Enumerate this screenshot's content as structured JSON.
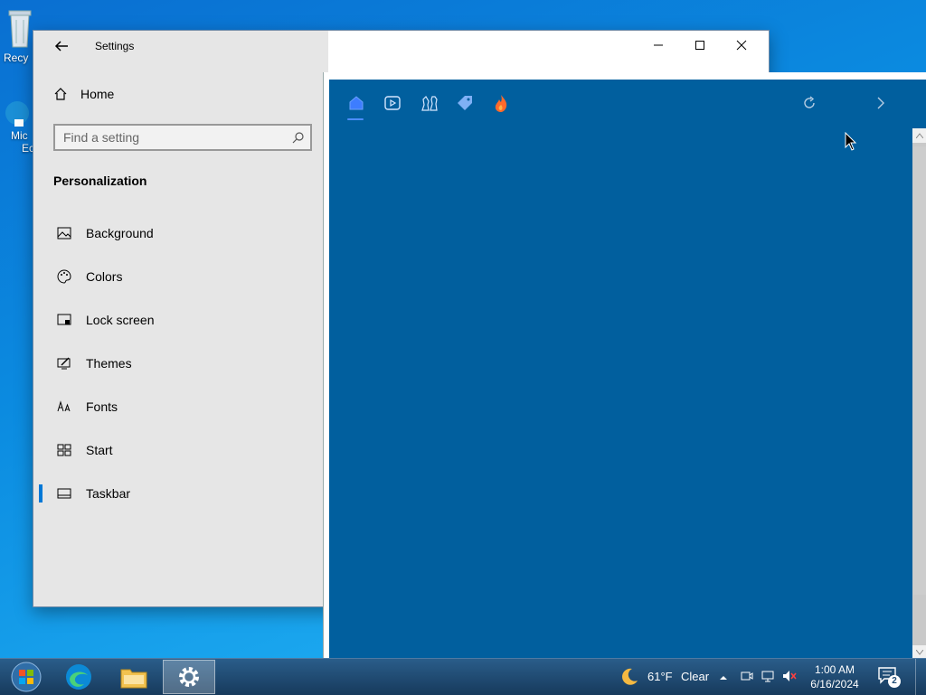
{
  "desktop": {
    "icons": [
      {
        "label": "Recy"
      },
      {
        "label": "Mic"
      },
      {
        "label": "Ec"
      }
    ]
  },
  "settings": {
    "window_title": "Settings",
    "home_label": "Home",
    "search": {
      "placeholder": "Find a setting",
      "value": ""
    },
    "section_title": "Personalization",
    "nav_items": [
      {
        "label": "Background",
        "icon": "picture-icon"
      },
      {
        "label": "Colors",
        "icon": "palette-icon"
      },
      {
        "label": "Lock screen",
        "icon": "lock-screen-icon"
      },
      {
        "label": "Themes",
        "icon": "themes-icon"
      },
      {
        "label": "Fonts",
        "icon": "fonts-icon"
      },
      {
        "label": "Start",
        "icon": "start-icon"
      },
      {
        "label": "Taskbar",
        "icon": "taskbar-icon",
        "selected": true
      }
    ],
    "accent_color": "#0078d7"
  },
  "app": {
    "background_color": "#015f9e",
    "toolbar_icons": [
      "home-icon",
      "video-icon",
      "chess-icon",
      "tag-icon",
      "fire-icon"
    ]
  },
  "taskbar": {
    "weather": {
      "temp": "61°F",
      "condition": "Clear"
    },
    "clock": {
      "time": "1:00 AM",
      "date": "6/16/2024"
    },
    "notification_count": "2"
  }
}
